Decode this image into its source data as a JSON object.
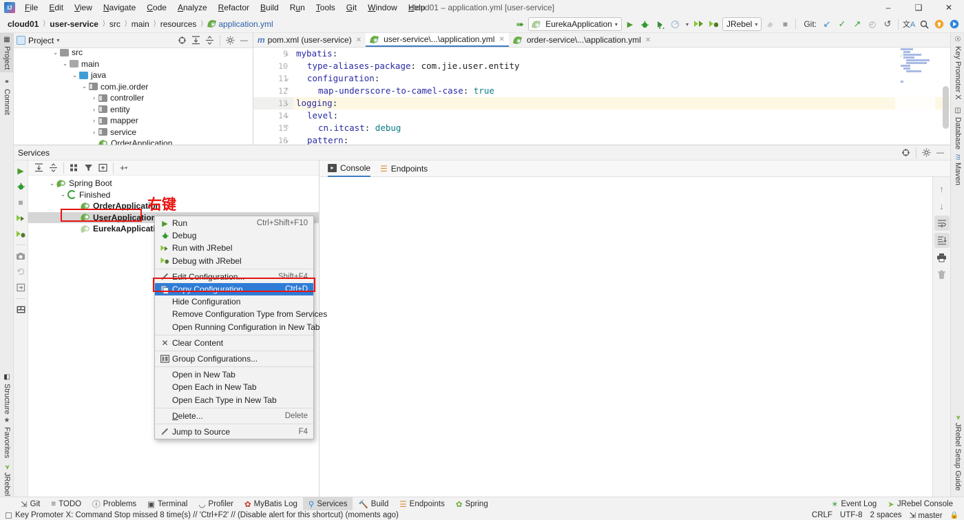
{
  "window": {
    "title": "cloud01 – application.yml [user-service]",
    "minimize": "–",
    "maximize": "❐",
    "close": "✕"
  },
  "menu": [
    {
      "label": "File",
      "mnemonic": "F"
    },
    {
      "label": "Edit",
      "mnemonic": "E"
    },
    {
      "label": "View",
      "mnemonic": "V"
    },
    {
      "label": "Navigate",
      "mnemonic": "N"
    },
    {
      "label": "Code",
      "mnemonic": "C"
    },
    {
      "label": "Analyze",
      "mnemonic": "A"
    },
    {
      "label": "Refactor",
      "mnemonic": "R"
    },
    {
      "label": "Build",
      "mnemonic": "B"
    },
    {
      "label": "Run",
      "mnemonic": "u"
    },
    {
      "label": "Tools",
      "mnemonic": "T"
    },
    {
      "label": "Git",
      "mnemonic": "G"
    },
    {
      "label": "Window",
      "mnemonic": "W"
    },
    {
      "label": "Help",
      "mnemonic": "H"
    }
  ],
  "breadcrumb": [
    {
      "label": "cloud01",
      "style": "bold"
    },
    {
      "label": "user-service",
      "style": "bold"
    },
    {
      "label": "src",
      "style": "normal"
    },
    {
      "label": "main",
      "style": "normal"
    },
    {
      "label": "resources",
      "style": "normal"
    },
    {
      "label": "application.yml",
      "style": "link"
    }
  ],
  "toolbar": {
    "back_arrow": "↖",
    "run_config": "EurekaApplication",
    "run_config_caret": "▾",
    "jrebel_label": "JRebel",
    "jrebel_caret": "▾",
    "run_tooltip": "Run",
    "debug_tooltip": "Debug",
    "git_label": "Git:",
    "git_update": "↙",
    "git_commit": "✓",
    "git_push": "↗",
    "git_history": "◔",
    "git_rollback": "↺",
    "translate": "文A",
    "search": "🔍",
    "updates": "↑",
    "play": "▶"
  },
  "left_strip": [
    {
      "label": "Project",
      "icon": "project-icon",
      "active": true
    },
    {
      "label": "Commit",
      "icon": "commit-icon",
      "active": false
    },
    {
      "label": "Structure",
      "icon": "structure-icon",
      "active": false
    },
    {
      "label": "Favorites",
      "icon": "star-icon",
      "active": false
    },
    {
      "label": "JRebel",
      "icon": "jrebel-icon",
      "active": false
    }
  ],
  "right_strip": [
    {
      "label": "Key Promoter X",
      "icon": "key-promoter-icon"
    },
    {
      "label": "Database",
      "icon": "database-icon"
    },
    {
      "label": "Maven",
      "icon": "maven-icon"
    },
    {
      "label": "JRebel Setup Guide",
      "icon": "jrebel-icon"
    }
  ],
  "project_panel": {
    "title": "Project",
    "title_caret": "▾",
    "icons": [
      "target-icon",
      "expand-all-icon",
      "collapse-all-icon",
      "gear-icon",
      "minimize-icon"
    ],
    "tree": [
      {
        "label": "src",
        "depth": 2,
        "twisty": "⌄",
        "icon": "folder-src",
        "clipped": true
      },
      {
        "label": "main",
        "depth": 3,
        "twisty": "⌄",
        "icon": "folder-gray"
      },
      {
        "label": "java",
        "depth": 4,
        "twisty": "⌄",
        "icon": "folder-blue"
      },
      {
        "label": "com.jie.order",
        "depth": 5,
        "twisty": "⌄",
        "icon": "folder-package"
      },
      {
        "label": "controller",
        "depth": 6,
        "twisty": "›",
        "icon": "folder-package"
      },
      {
        "label": "entity",
        "depth": 6,
        "twisty": "›",
        "icon": "folder-package"
      },
      {
        "label": "mapper",
        "depth": 6,
        "twisty": "›",
        "icon": "folder-package"
      },
      {
        "label": "service",
        "depth": 6,
        "twisty": "›",
        "icon": "folder-package"
      },
      {
        "label": "OrderApplication",
        "depth": 6,
        "twisty": "",
        "icon": "spring-class-icon"
      }
    ]
  },
  "editor": {
    "tabs": [
      {
        "label": "pom.xml (user-service)",
        "icon": "maven-m-icon",
        "active": false
      },
      {
        "label": "user-service\\...\\application.yml",
        "icon": "spring-yml-icon",
        "active": true
      },
      {
        "label": "order-service\\...\\application.yml",
        "icon": "spring-yml-icon",
        "active": false
      }
    ],
    "close_glyph": "✕",
    "inspection_ok": "✔",
    "lines": [
      {
        "num": "9",
        "indent": 2,
        "fold": "⌄",
        "key": "mybatis",
        "sep": ":",
        "value": "",
        "highlight": false
      },
      {
        "num": "10",
        "indent": 4,
        "fold": "",
        "key": "type-aliases-package",
        "sep": ":",
        "value": " com.jie.user.entity",
        "highlight": false
      },
      {
        "num": "11",
        "indent": 4,
        "fold": "⌄",
        "key": "configuration",
        "sep": ":",
        "value": "",
        "highlight": false
      },
      {
        "num": "12",
        "indent": 6,
        "fold": "⌃",
        "key": "map-underscore-to-camel-case",
        "sep": ":",
        "value": " true",
        "highlight": false
      },
      {
        "num": "13",
        "indent": 2,
        "fold": "⌄",
        "key": "logging",
        "sep": ":",
        "value": "",
        "highlight": true
      },
      {
        "num": "14",
        "indent": 4,
        "fold": "⌄",
        "key": "level",
        "sep": ":",
        "value": "",
        "highlight": false
      },
      {
        "num": "15",
        "indent": 6,
        "fold": "⌃",
        "key": "cn.itcast",
        "sep": ":",
        "value": " debug",
        "highlight": false
      },
      {
        "num": "16",
        "indent": 4,
        "fold": "⌄",
        "key": "pattern",
        "sep": ":",
        "value": "",
        "highlight": false
      }
    ]
  },
  "services": {
    "title": "Services",
    "head_icons": [
      "target-icon",
      "gear-icon",
      "minimize-icon"
    ],
    "vertical_toolbar": [
      "run-icon",
      "debug-icon",
      "stop-icon",
      "run-jrebel-icon",
      "debug-jrebel-icon",
      "camera-icon",
      "rerun-failed-icon",
      "export-icon",
      "layout-icon"
    ],
    "toolbar2": [
      "expand-all-icon",
      "collapse-all-icon",
      "group-icon",
      "filter-icon",
      "new-tab-icon",
      "add-icon"
    ],
    "tree": [
      {
        "label": "Spring Boot",
        "depth": 1,
        "twisty": "⌄",
        "icon": "spring-icon",
        "bold": false,
        "selected": false
      },
      {
        "label": "Finished",
        "depth": 2,
        "twisty": "⌄",
        "icon": "restart-icon",
        "bold": false,
        "selected": false
      },
      {
        "label": "OrderApplication",
        "depth": 4,
        "twisty": "",
        "icon": "spring-icon",
        "bold": true,
        "selected": false
      },
      {
        "label": "UserApplication",
        "depth": 4,
        "twisty": "",
        "icon": "spring-icon",
        "bold": true,
        "selected": true
      },
      {
        "label": "EurekaApplication",
        "depth": 4,
        "twisty": "",
        "icon": "spring-icon-dim",
        "bold": true,
        "selected": false
      }
    ],
    "console_tabs": [
      {
        "label": "Console",
        "icon": "console-icon",
        "active": true
      },
      {
        "label": "Endpoints",
        "icon": "endpoints-icon",
        "active": false
      }
    ],
    "console_tools": [
      {
        "name": "up-icon",
        "glyph": "↑",
        "on": false
      },
      {
        "name": "down-icon",
        "glyph": "↓",
        "on": false
      },
      {
        "name": "soft-wrap-icon",
        "glyph": "⇥",
        "on": true
      },
      {
        "name": "scroll-to-end-icon",
        "glyph": "⇟",
        "on": true
      },
      {
        "name": "print-icon",
        "glyph": "⎙",
        "on": false
      },
      {
        "name": "trash-icon",
        "glyph": "🗑",
        "on": false
      }
    ]
  },
  "annotation": {
    "right_click_cn": "右键",
    "highlight_color": "#e8130f"
  },
  "context_menu": {
    "selected_index": 5,
    "items": [
      {
        "label": "Run",
        "shortcut": "Ctrl+Shift+F10",
        "icon": "run-icon",
        "type": "item"
      },
      {
        "label": "Debug",
        "shortcut": "",
        "icon": "debug-icon",
        "type": "item"
      },
      {
        "label": "Run with JRebel",
        "shortcut": "",
        "icon": "run-jrebel-icon",
        "type": "item"
      },
      {
        "label": "Debug with JRebel",
        "shortcut": "",
        "icon": "debug-jrebel-icon",
        "type": "item"
      },
      {
        "type": "separator"
      },
      {
        "label": "Edit Configuration...",
        "shortcut": "Shift+F4",
        "icon": "pencil-icon",
        "type": "item"
      },
      {
        "label": "Copy Configuration...",
        "shortcut": "Ctrl+D",
        "icon": "copy-icon",
        "type": "item",
        "selected": true
      },
      {
        "label": "Hide Configuration",
        "shortcut": "",
        "icon": "",
        "type": "item"
      },
      {
        "label": "Remove Configuration Type from Services",
        "shortcut": "",
        "icon": "",
        "type": "item"
      },
      {
        "label": "Open Running Configuration in New Tab",
        "shortcut": "",
        "icon": "",
        "type": "item"
      },
      {
        "type": "separator"
      },
      {
        "label": "Clear Content",
        "shortcut": "",
        "icon": "clear-icon",
        "type": "item"
      },
      {
        "type": "separator"
      },
      {
        "label": "Group Configurations...",
        "shortcut": "",
        "icon": "group-icon",
        "type": "item"
      },
      {
        "type": "separator"
      },
      {
        "label": "Open in New Tab",
        "shortcut": "",
        "icon": "",
        "type": "item"
      },
      {
        "label": "Open Each in New Tab",
        "shortcut": "",
        "icon": "",
        "type": "item"
      },
      {
        "label": "Open Each Type in New Tab",
        "shortcut": "",
        "icon": "",
        "type": "item"
      },
      {
        "type": "separator"
      },
      {
        "label": "Delete...",
        "shortcut": "Delete",
        "icon": "",
        "type": "item",
        "mnemonic": "D"
      },
      {
        "type": "separator"
      },
      {
        "label": "Jump to Source",
        "shortcut": "F4",
        "icon": "pencil-icon",
        "type": "item"
      }
    ]
  },
  "bottom_tabs": [
    {
      "label": "Git",
      "icon": "git-icon",
      "active": false
    },
    {
      "label": "TODO",
      "icon": "todo-icon",
      "active": false
    },
    {
      "label": "Problems",
      "icon": "problems-icon",
      "active": false
    },
    {
      "label": "Terminal",
      "icon": "terminal-icon",
      "active": false
    },
    {
      "label": "Profiler",
      "icon": "profiler-icon",
      "active": false
    },
    {
      "label": "MyBatis Log",
      "icon": "mybatis-icon",
      "active": false
    },
    {
      "label": "Services",
      "icon": "services-icon",
      "active": true
    },
    {
      "label": "Build",
      "icon": "build-icon",
      "active": false
    },
    {
      "label": "Endpoints",
      "icon": "endpoints-icon",
      "active": false
    },
    {
      "label": "Spring",
      "icon": "spring-icon",
      "active": false
    }
  ],
  "bottom_tabs_right": [
    {
      "label": "Event Log",
      "icon": "event-log-icon"
    },
    {
      "label": "JRebel Console",
      "icon": "jrebel-icon"
    }
  ],
  "statusbar": {
    "message": "Key Promoter X: Command Stop missed 8 time(s) // 'Ctrl+F2' // (Disable alert for this shortcut) (moments ago)",
    "line_separator": "CRLF",
    "encoding": "UTF-8",
    "indent": "2 spaces",
    "branch": "master",
    "branch_icon": "branch-icon",
    "lock_icon": "🔒"
  }
}
